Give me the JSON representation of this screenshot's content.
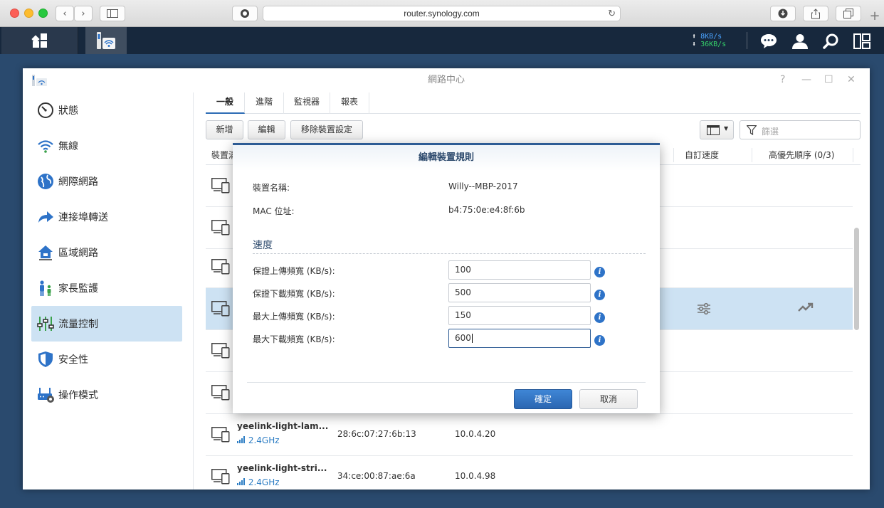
{
  "browser": {
    "url": "router.synology.com"
  },
  "taskbar": {
    "upload_speed": "8KB/s",
    "download_speed": "36KB/s"
  },
  "window": {
    "title": "網路中心",
    "controls": [
      "?",
      "—",
      "☐",
      "✕"
    ]
  },
  "sidebar": {
    "items": [
      {
        "label": "狀態",
        "icon": "gauge-icon"
      },
      {
        "label": "無線",
        "icon": "wifi-icon"
      },
      {
        "label": "網際網路",
        "icon": "globe-icon"
      },
      {
        "label": "連接埠轉送",
        "icon": "forward-arrow-icon"
      },
      {
        "label": "區域網路",
        "icon": "home-network-icon"
      },
      {
        "label": "家長監護",
        "icon": "family-icon"
      },
      {
        "label": "流量控制",
        "icon": "sliders-icon",
        "active": true
      },
      {
        "label": "安全性",
        "icon": "shield-icon"
      },
      {
        "label": "操作模式",
        "icon": "router-gear-icon"
      }
    ]
  },
  "tabs": [
    {
      "label": "一般",
      "active": true
    },
    {
      "label": "進階"
    },
    {
      "label": "監視器"
    },
    {
      "label": "報表"
    }
  ],
  "toolbar": {
    "add_label": "新增",
    "edit_label": "編輯",
    "remove_label": "移除裝置設定",
    "filter_placeholder": "篩選"
  },
  "table": {
    "headers": {
      "device": "裝置清",
      "custom_speed": "自訂速度",
      "priority": "高優先順序 (0/3)"
    },
    "rows": [
      {
        "name": "",
        "band": "",
        "mac": "",
        "ip": ""
      },
      {
        "name": "",
        "band": "",
        "mac": "",
        "ip": ""
      },
      {
        "name": "",
        "band": "",
        "mac": "",
        "ip": ""
      },
      {
        "name": "",
        "band": "",
        "mac": "",
        "ip": "",
        "selected": true
      },
      {
        "name": "",
        "band": "",
        "mac": "",
        "ip": ""
      },
      {
        "name": "",
        "band": "",
        "mac": "",
        "ip": ""
      },
      {
        "name": "yeelink-light-lam...",
        "band": "2.4GHz",
        "mac": "28:6c:07:27:6b:13",
        "ip": "10.0.4.20"
      },
      {
        "name": "yeelink-light-stri...",
        "band": "2.4GHz",
        "mac": "34:ce:00:87:ae:6a",
        "ip": "10.0.4.98"
      }
    ]
  },
  "dialog": {
    "title": "編輯裝置規則",
    "device_name_label": "裝置名稱:",
    "device_name_value": "Willy--MBP-2017",
    "mac_label": "MAC 位址:",
    "mac_value": "b4:75:0e:e4:8f:6b",
    "section_title": "速度",
    "fields": [
      {
        "label": "保證上傳頻寬 (KB/s):",
        "value": "100"
      },
      {
        "label": "保證下載頻寬 (KB/s):",
        "value": "500"
      },
      {
        "label": "最大上傳頻寬 (KB/s):",
        "value": "150"
      },
      {
        "label": "最大下載頻寬 (KB/s):",
        "value": "600"
      }
    ],
    "ok_label": "確定",
    "cancel_label": "取消"
  },
  "colors": {
    "accent": "#2d5b94",
    "selection": "#cde2f3",
    "link": "#2e7ec4"
  }
}
